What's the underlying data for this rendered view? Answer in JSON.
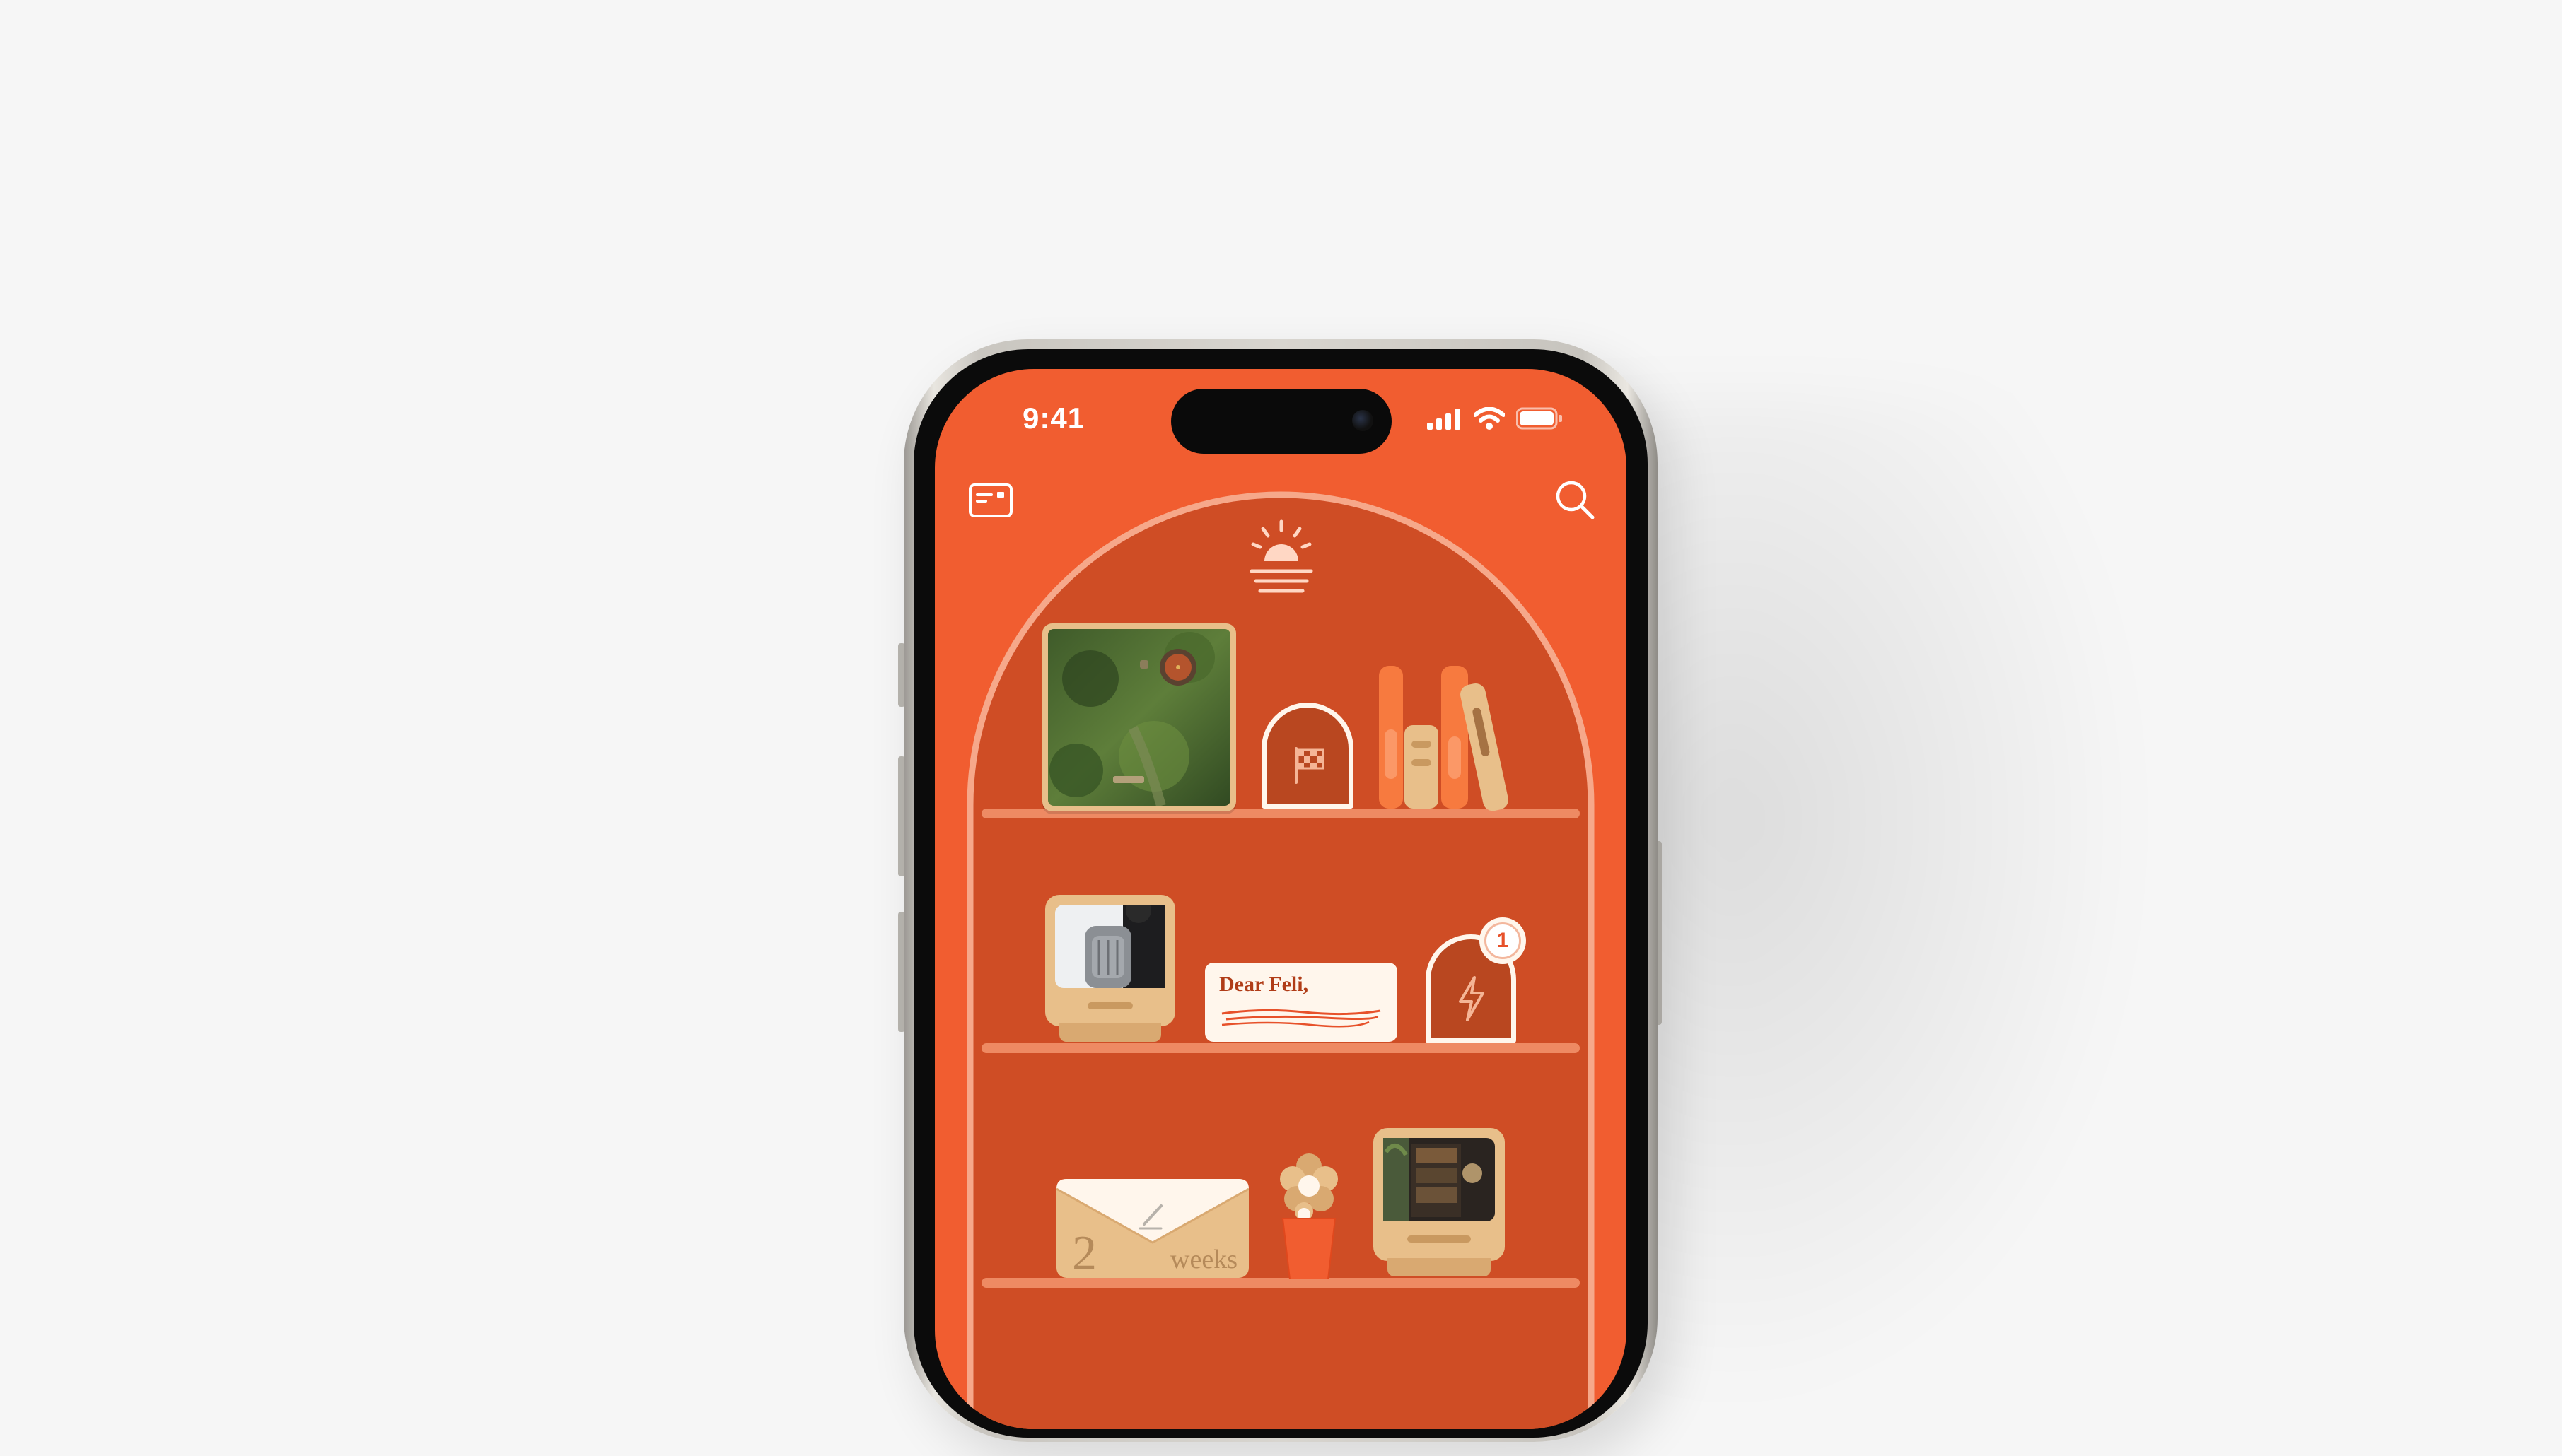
{
  "status_bar": {
    "time": "9:41"
  },
  "toolbar": {
    "left_icon": "card-icon",
    "right_icon": "search-icon"
  },
  "shelf": {
    "header_icon": "sunrise-icon",
    "row1": {
      "photo": "hobbit-door-photo",
      "arch_icon": "checkered-flag-icon",
      "books": "books"
    },
    "row2": {
      "photo": "backpack-photo",
      "note_text": "Dear Feli,",
      "notification_count": "1",
      "arch_icon": "lightning-icon"
    },
    "row3": {
      "envelope_number": "2",
      "envelope_unit": "weeks",
      "flower": "flower-vase",
      "photo": "interior-photo"
    }
  },
  "colors": {
    "background": "#f6f6f6",
    "screen": "#f15d30",
    "arch_inner": "#cf4d25",
    "shelf": "#ee8a63",
    "tan": "#e8bf8a",
    "cream": "#fff6ec"
  }
}
